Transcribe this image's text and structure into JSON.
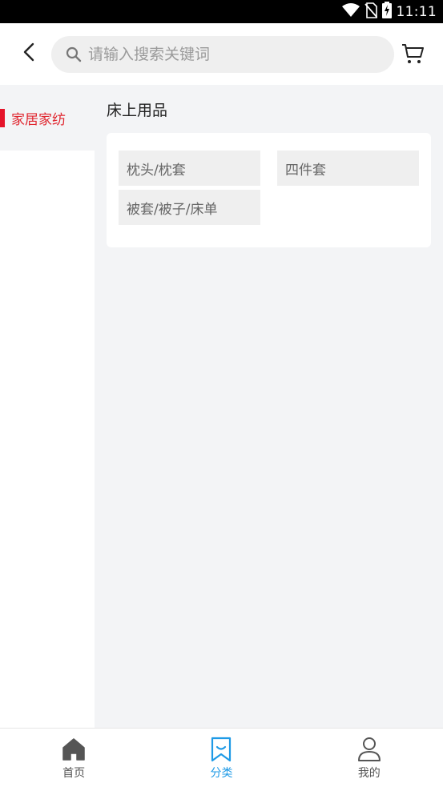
{
  "status_bar": {
    "time": "11:11",
    "icons": [
      "wifi-icon",
      "no-sim-icon",
      "battery-charging-icon"
    ]
  },
  "header": {
    "back_icon": "chevron-left-icon",
    "search": {
      "placeholder": "请输入搜索关键词",
      "value": "",
      "icon": "search-icon"
    },
    "cart_icon": "cart-icon"
  },
  "sidebar": {
    "items": [
      {
        "label": "家居家纺",
        "selected": true
      }
    ],
    "accent_color": "#e5142a"
  },
  "main": {
    "section_title": "床上用品",
    "tags": [
      "枕头/枕套",
      "四件套",
      "被套/被子/床单"
    ]
  },
  "tabbar": {
    "tabs": [
      {
        "label": "首页",
        "icon": "home-icon",
        "active": false
      },
      {
        "label": "分类",
        "icon": "category-bookmark-icon",
        "active": true
      },
      {
        "label": "我的",
        "icon": "user-icon",
        "active": false
      }
    ],
    "active_color": "#1e9ae6"
  }
}
